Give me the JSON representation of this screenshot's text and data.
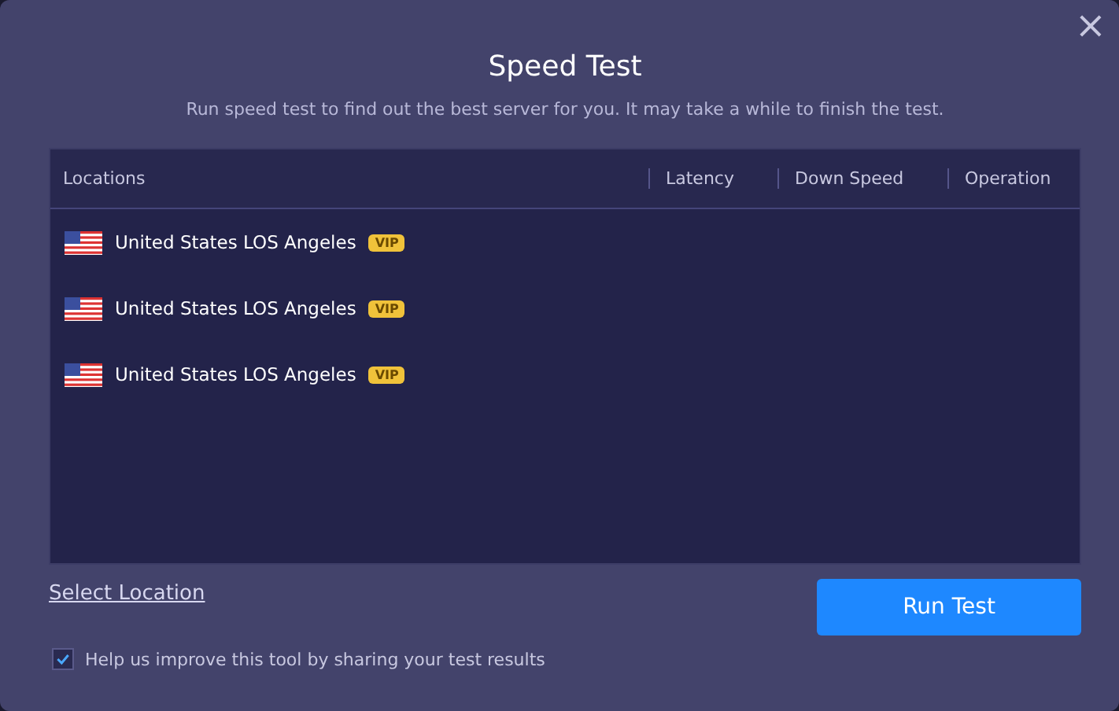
{
  "dialog": {
    "title": "Speed Test",
    "subtitle": "Run speed test to find out the best server for you. It may take a while to finish the test.",
    "close": "×"
  },
  "table": {
    "columns": [
      "Locations",
      "Latency",
      "Down Speed",
      "Operation"
    ],
    "rows": [
      {
        "location": "United States LOS Angeles",
        "badge": "VIP"
      },
      {
        "location": "United States LOS Angeles",
        "badge": "VIP"
      },
      {
        "location": "United States LOS Angeles",
        "badge": "VIP"
      }
    ]
  },
  "select_location": "Select Location",
  "run_button": "Run Test",
  "share": {
    "label": "Help us improve this tool by sharing your test results",
    "checked": true
  }
}
